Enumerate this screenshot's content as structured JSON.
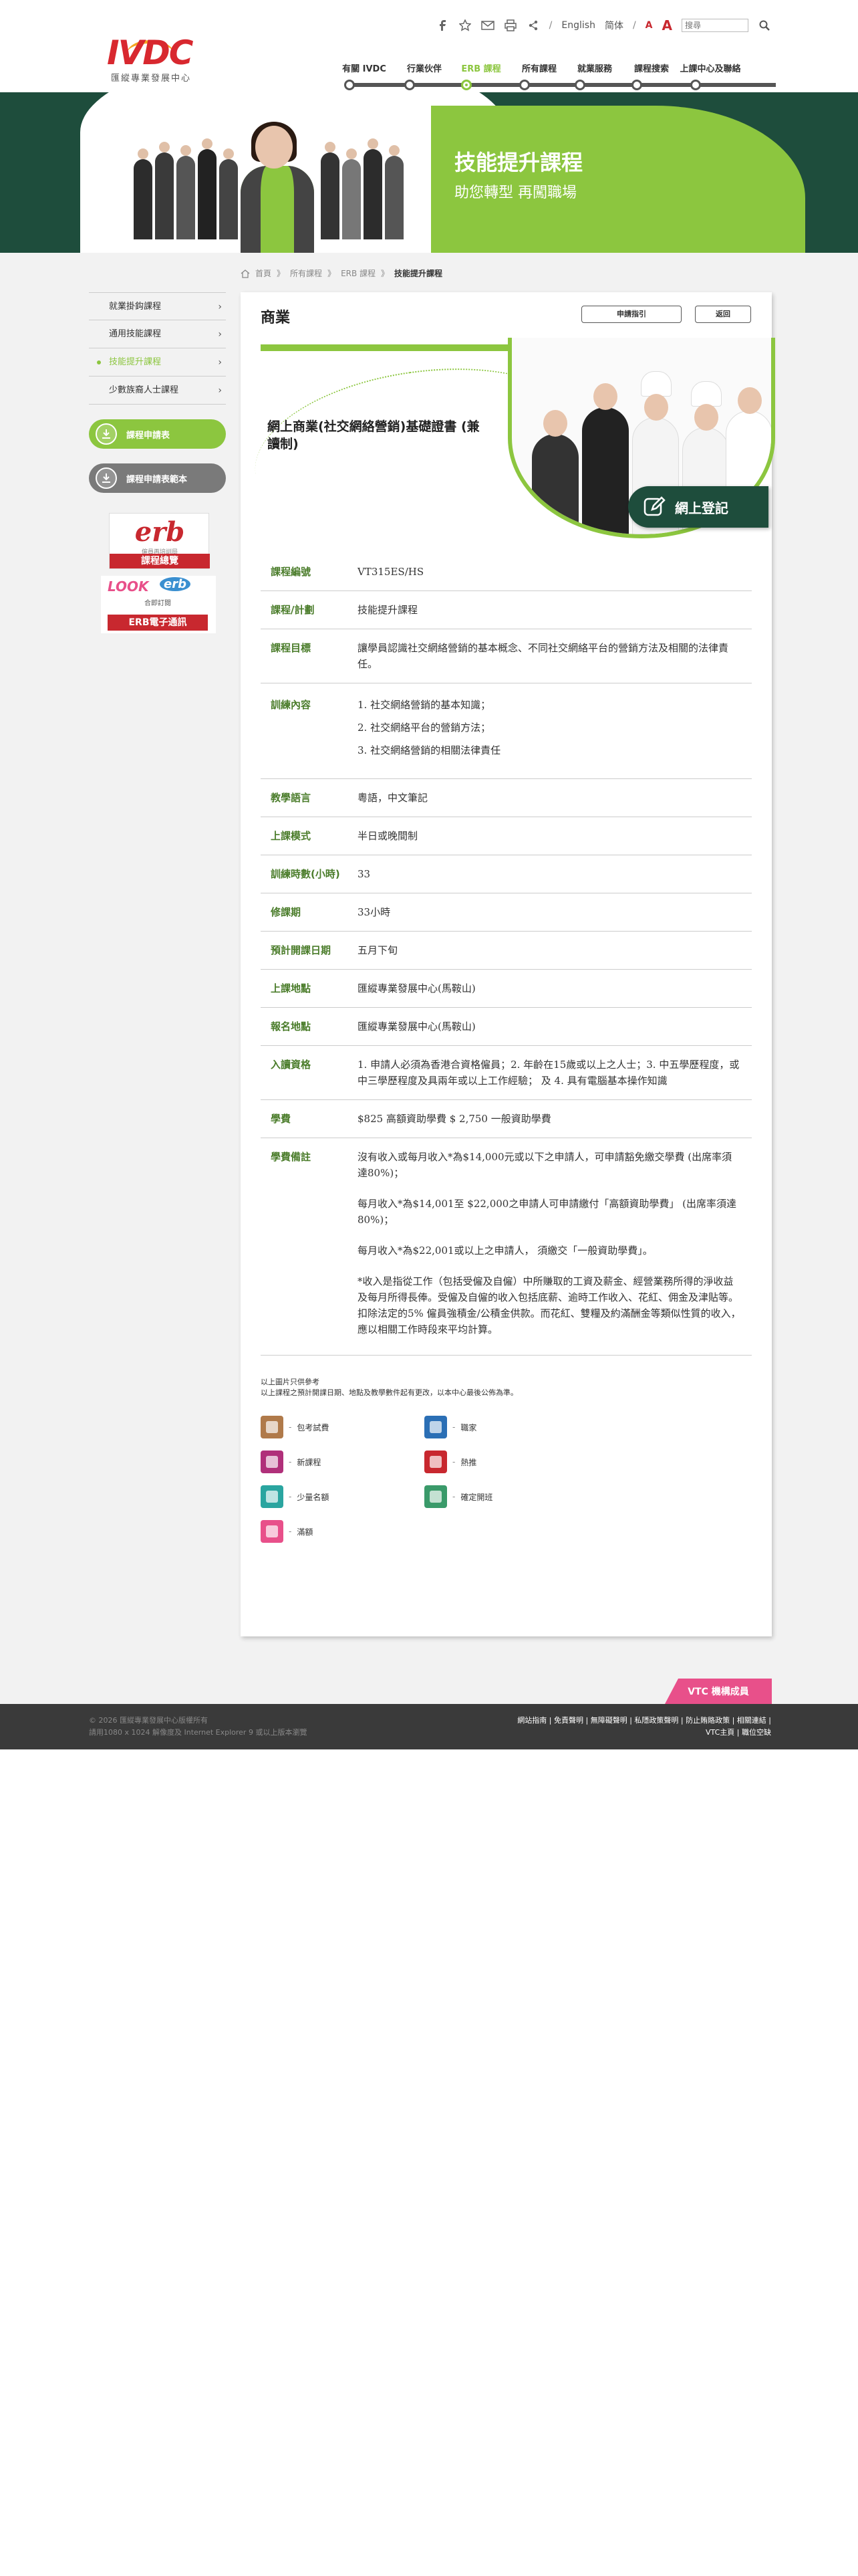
{
  "logo": {
    "text": "IVDC",
    "subtitle": "匯縱專業發展中心"
  },
  "toolbar": {
    "lang_en": "English",
    "lang_sc": "简体",
    "font_small": "A",
    "font_large": "A",
    "search_placeholder": "搜尋"
  },
  "nav": {
    "items": [
      {
        "label": "有關 IVDC"
      },
      {
        "label": "行業伙伴"
      },
      {
        "label": "ERB 課程"
      },
      {
        "label": "所有課程"
      },
      {
        "label": "就業服務"
      },
      {
        "label": "課程搜索"
      },
      {
        "label": "上課中心及聯絡"
      }
    ]
  },
  "banner": {
    "title": "技能提升課程",
    "subtitle": "助您轉型 再闖職場"
  },
  "breadcrumb": {
    "home": "首頁",
    "all": "所有課程",
    "erb": "ERB 課程",
    "current": "技能提升課程"
  },
  "sidebar": {
    "items": [
      {
        "label": "就業掛鈎課程"
      },
      {
        "label": "通用技能課程"
      },
      {
        "label": "技能提升課程"
      },
      {
        "label": "少數族裔人士課程"
      }
    ],
    "btn_apply": "課程申請表",
    "btn_sample": "課程申請表範本",
    "ad1": {
      "title": "erb",
      "tag": "僱員再培訓局",
      "bar": "課程總覽"
    },
    "ad2": {
      "look": "LOOK",
      "erb": "erb",
      "sub": "合即訂閱",
      "bar": "ERB電子通訊"
    }
  },
  "panel": {
    "title": "商業",
    "apply_btn": "申請指引",
    "back_btn": "返回",
    "course_name": "網上商業(社交網絡營銷)基礎證書 (兼讀制)",
    "apply_online": "網上登記"
  },
  "details": {
    "rows": [
      {
        "label": "課程編號",
        "value": "VT315ES/HS"
      },
      {
        "label": "課程/計劃",
        "value": "技能提升課程"
      },
      {
        "label": "課程目標",
        "value": "讓學員認識社交網絡營銷的基本概念、不同社交網絡平台的營銷方法及相關的法律責任。"
      },
      {
        "label": "訓練內容",
        "p1": "1. 社交網絡營銷的基本知識；",
        "p2": "2. 社交網絡平台的營銷方法；",
        "p3": "3. 社交網絡營銷的相關法律責任"
      },
      {
        "label": "教學語言",
        "value": "粵語，中文筆記"
      },
      {
        "label": "上課模式",
        "value": "半日或晚間制"
      },
      {
        "label": "訓練時數(小時)",
        "value": "33"
      },
      {
        "label": "修課期",
        "value": "33小時"
      },
      {
        "label": "預計開課日期",
        "value": "五月下旬"
      },
      {
        "label": "上課地點",
        "value": "匯縱專業發展中心(馬鞍山)"
      },
      {
        "label": "報名地點",
        "value": "匯縱專業發展中心(馬鞍山)"
      },
      {
        "label": "入讀資格",
        "value": "1. 申請人必須為香港合資格僱員；2. 年齡在15歲或以上之人士；3. 中五學歷程度，或中三學歷程度及具兩年或以上工作經驗； 及 4. 具有電腦基本操作知識"
      },
      {
        "label": "學費",
        "value": "$825 高額資助學費 $ 2,750 一般資助學費"
      },
      {
        "label": "學費備註",
        "p1": "沒有收入或每月收入*為$14,000元或以下之申請人，可申請豁免繳交學費 (出席率須達80%)；",
        "p2": "每月收入*為$14,001至 $22,000之申請人可申請繳付「高額資助學費」 (出席率須達80%)；",
        "p3": "每月收入*為$22,001或以上之申請人， 須繳交「一般資助學費」。",
        "p4": "*收入是指從工作（包括受僱及自僱）中所賺取的工資及薪金、經營業務所得的淨收益及每月所得長俸。受僱及自僱的收入包括底薪、逾時工作收入、花紅、佣金及津貼等。扣除法定的5% 僱員強積金/公積金供款。而花紅、雙糧及約滿酬金等類似性質的收入，應以相關工作時段來平均計算。"
      }
    ]
  },
  "notes": {
    "line1": "以上圖片只供參考",
    "line2": "以上課程之預計開課日期、地點及教學數件起有更改，以本中心最後公佈為準。"
  },
  "legend": {
    "items": [
      {
        "label": "包考試費",
        "color": "#b07a4a"
      },
      {
        "label": "職家",
        "color": "#2b6fb5"
      },
      {
        "label": "新課程",
        "color": "#b0307a"
      },
      {
        "label": "熱推",
        "color": "#c8282f"
      },
      {
        "label": "少量名額",
        "color": "#2aa5a0"
      },
      {
        "label": "確定開班",
        "color": "#3a9a6a"
      },
      {
        "label": "滿額",
        "color": "#e8508a"
      }
    ]
  },
  "footer": {
    "vtc": "VTC 機構成員",
    "copyright": "© 2026 匯縱專業發展中心版權所有",
    "browser": "請用1080 x 1024 解像度及 Internet Explorer 9 或以上版本瀏覽",
    "links": "網站指南 | 免責聲明 | 無障礙聲明 | 私隱政策聲明 | 防止賄賂政策 | 相關連結 |",
    "links2": "VTC主頁 | 職位空缺"
  },
  "colors": {
    "brand_green": "#8cc63f",
    "dark_green": "#1e4d3c",
    "brand_red": "#c8282f",
    "pink": "#e8508a"
  }
}
